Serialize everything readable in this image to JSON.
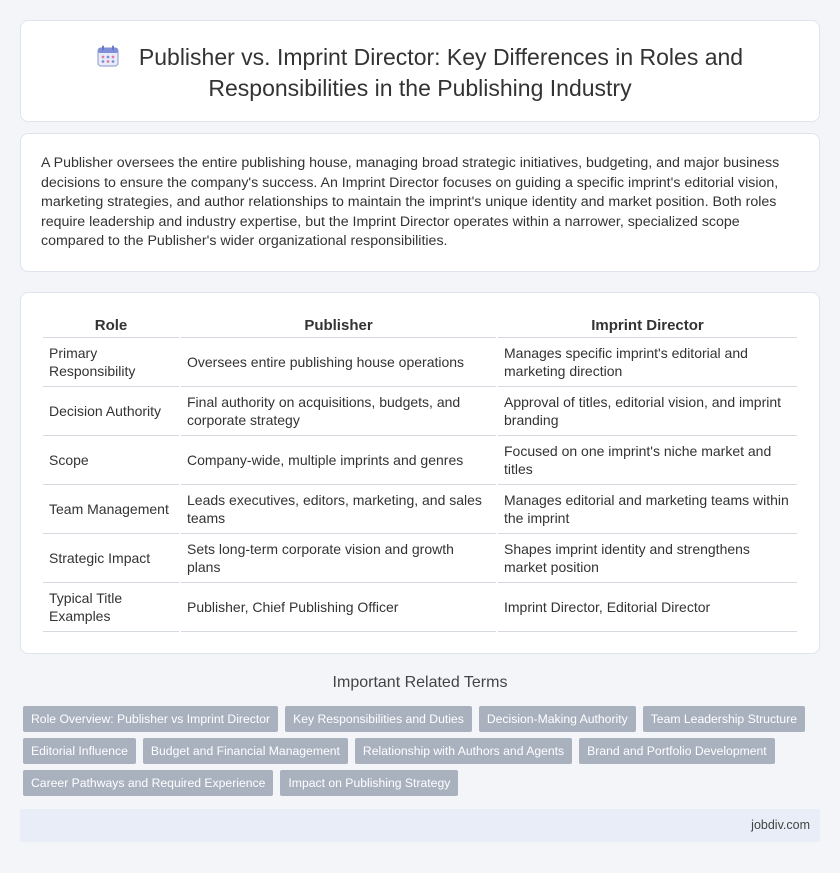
{
  "header": {
    "icon": "calendar-icon",
    "title_line1": "Publisher vs. Imprint Director: Key Differences in Roles and",
    "title_line2": "Responsibilities in the Publishing Industry"
  },
  "intro": {
    "text": "A Publisher oversees the entire publishing house, managing broad strategic initiatives, budgeting, and major business decisions to ensure the company's success. An Imprint Director focuses on guiding a specific imprint's editorial vision, marketing strategies, and author relationships to maintain the imprint's unique identity and market position. Both roles require leadership and industry expertise, but the Imprint Director operates within a narrower, specialized scope compared to the Publisher's wider organizational responsibilities."
  },
  "table": {
    "headers": [
      "Role",
      "Publisher",
      "Imprint Director"
    ],
    "rows": [
      [
        "Primary Responsibility",
        "Oversees entire publishing house operations",
        "Manages specific imprint's editorial and marketing direction"
      ],
      [
        "Decision Authority",
        "Final authority on acquisitions, budgets, and corporate strategy",
        "Approval of titles, editorial vision, and imprint branding"
      ],
      [
        "Scope",
        "Company-wide, multiple imprints and genres",
        "Focused on one imprint's niche market and titles"
      ],
      [
        "Team Management",
        "Leads executives, editors, marketing, and sales teams",
        "Manages editorial and marketing teams within the imprint"
      ],
      [
        "Strategic Impact",
        "Sets long-term corporate vision and growth plans",
        "Shapes imprint identity and strengthens market position"
      ],
      [
        "Typical Title Examples",
        "Publisher, Chief Publishing Officer",
        "Imprint Director, Editorial Director"
      ]
    ]
  },
  "related": {
    "title": "Important Related Terms",
    "tags": [
      "Role Overview: Publisher vs Imprint Director",
      "Key Responsibilities and Duties",
      "Decision-Making Authority",
      "Team Leadership Structure",
      "Editorial Influence",
      "Budget and Financial Management",
      "Relationship with Authors and Agents",
      "Brand and Portfolio Development",
      "Career Pathways and Required Experience",
      "Impact on Publishing Strategy"
    ]
  },
  "footer": {
    "site": "jobdiv.com"
  },
  "colors": {
    "tag_bg": "#a9b1bf",
    "footer_bg": "#e8edf7",
    "page_bg": "#f4f5f8"
  }
}
